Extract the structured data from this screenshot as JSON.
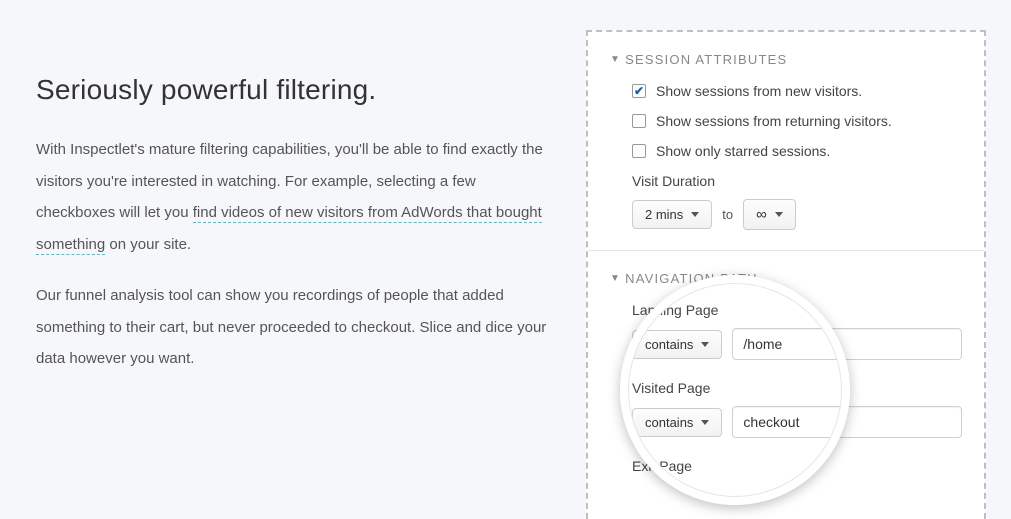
{
  "left": {
    "heading": "Seriously powerful filtering.",
    "p1a": "With Inspectlet's mature filtering capabilities, you'll be able to find exactly the visitors you're interested in watching. For example, selecting a few checkboxes will let you ",
    "p1_highlight": "find videos of new visitors from AdWords that bought something",
    "p1b": " on your site.",
    "p2": "Our funnel analysis tool can show you recordings of people that added something to their cart, but never proceeded to checkout. Slice and dice your data however you want."
  },
  "panel": {
    "session": {
      "title": "SESSION ATTRIBUTES",
      "opt_new": "Show sessions from new visitors.",
      "opt_returning": "Show sessions from returning visitors.",
      "opt_starred": "Show only starred sessions.",
      "duration_label": "Visit Duration",
      "duration_min": "2 mins",
      "duration_to": "to",
      "duration_max": "∞"
    },
    "nav": {
      "title": "NAVIGATION PATH",
      "landing_label": "Landing Page",
      "landing_op": "contains",
      "landing_value": "/home",
      "visited_label": "Visited Page",
      "visited_op": "contains",
      "visited_value": "checkout",
      "exit_label": "Exit Page"
    }
  }
}
